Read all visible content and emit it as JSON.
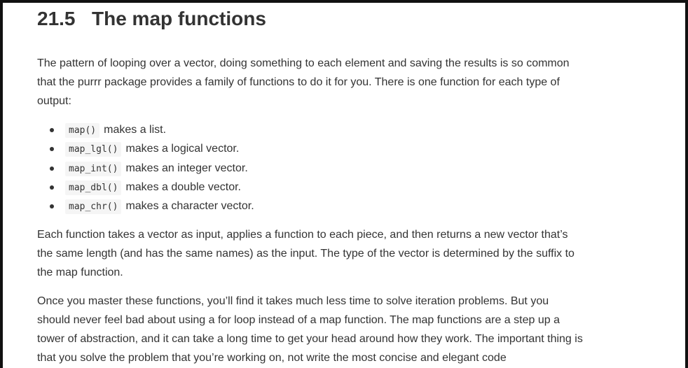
{
  "section": {
    "number": "21.5",
    "title": "The map functions"
  },
  "paragraphs": {
    "intro": "The pattern of looping over a vector, doing something to each element and saving the results is so common that the purrr package provides a family of functions to do it for you. There is one function for each type of output:",
    "second": "Each function takes a vector as input, applies a function to each piece, and then returns a new vector that’s the same length (and has the same names) as the input. The type of the vector is determined by the suffix to the map function.",
    "third": "Once you master these functions, you’ll find it takes much less time to solve iteration problems. But you should never feel bad about using a for loop instead of a map function. The map functions are a step up a tower of abstraction, and it can take a long time to get your head around how they work. The important thing is that you solve the problem that you’re working on, not write the most concise and elegant code"
  },
  "functions": [
    {
      "code": "map()",
      "desc": "makes a list."
    },
    {
      "code": "map_lgl()",
      "desc": "makes a logical vector."
    },
    {
      "code": "map_int()",
      "desc": "makes an integer vector."
    },
    {
      "code": "map_dbl()",
      "desc": "makes a double vector."
    },
    {
      "code": "map_chr()",
      "desc": "makes a character vector."
    }
  ]
}
